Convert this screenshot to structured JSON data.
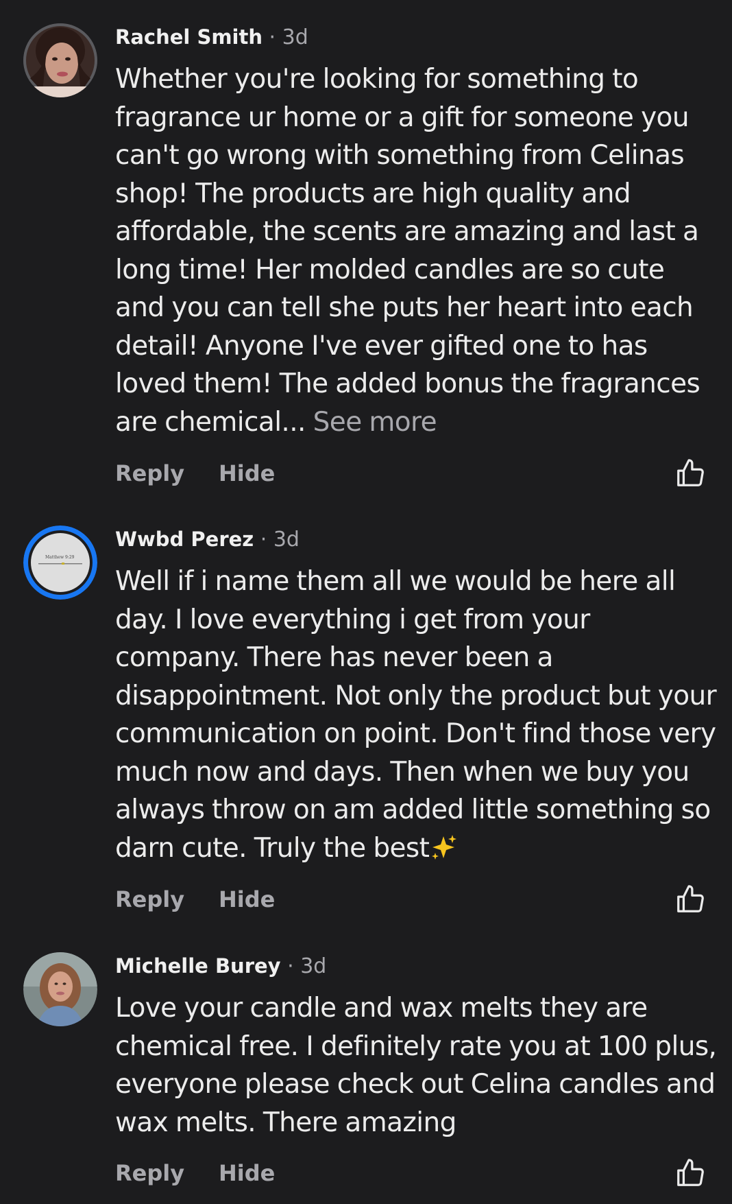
{
  "comments": [
    {
      "author": "Rachel Smith",
      "separator": "·",
      "time": "3d",
      "text": "Whether you're looking for something to fragrance ur home or a gift for someone you can't go wrong with something from Celinas shop! The products are high quality and affordable, the scents are amazing and last a long time! Her molded candles are so cute and you can tell she puts her heart into each detail! Anyone I've ever gifted one to has loved them! The added bonus the fragrances are chemical...",
      "see_more": "See more",
      "reply_label": "Reply",
      "hide_label": "Hide"
    },
    {
      "author": "Wwbd Perez",
      "separator": "·",
      "time": "3d",
      "avatar_caption": "Matthew 9:29",
      "text": "Well if i name them all we would be here all day.  I love everything i get from your company. There has never been a disappointment. Not only the product but your communication on point.  Don't find those very much now and days. Then when we buy you always throw on am added little something so darn cute. Truly the best",
      "reply_label": "Reply",
      "hide_label": "Hide"
    },
    {
      "author": "Michelle Burey",
      "separator": "·",
      "time": "3d",
      "text": "Love your candle and wax melts they are chemical free. I definitely rate you at 100 plus, everyone please check out Celina candles and wax melts. There amazing",
      "reply_label": "Reply",
      "hide_label": "Hide"
    }
  ],
  "colors": {
    "background": "#1c1c1e",
    "text_primary": "#ececec",
    "text_secondary": "#a8a8ad",
    "story_ring": "#1877f2"
  },
  "icons": {
    "like": "thumbs-up-outline-icon",
    "sparkle": "sparkles-emoji"
  }
}
